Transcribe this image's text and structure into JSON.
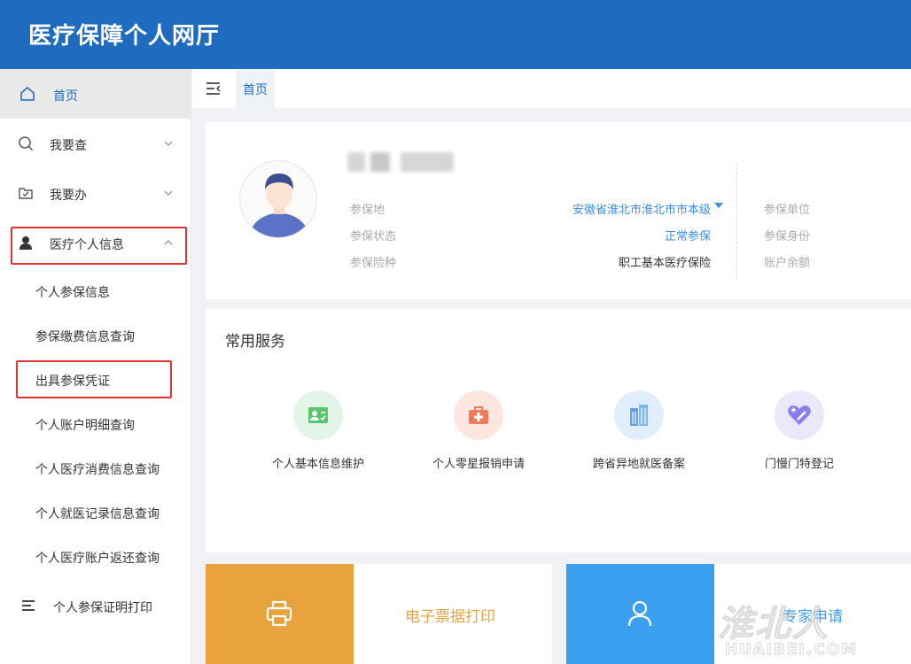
{
  "header": {
    "title": "医疗保障个人网厅"
  },
  "sidebar": {
    "home": "首页",
    "items": [
      {
        "label": "我要查",
        "icon": "search-icon",
        "expanded": false
      },
      {
        "label": "我要办",
        "icon": "folder-check-icon",
        "expanded": false
      },
      {
        "label": "医疗个人信息",
        "icon": "user-icon",
        "expanded": true
      }
    ],
    "sub_items": [
      "个人参保信息",
      "参保缴费信息查询",
      "出具参保凭证",
      "个人账户明细查询",
      "个人医疗消费信息查询",
      "个人就医记录信息查询",
      "个人医疗账户返还查询"
    ],
    "bottom_item": {
      "label": "个人参保证明打印",
      "icon": "list-icon"
    }
  },
  "tabbar": {
    "active_tab": "首页"
  },
  "profile": {
    "fields": [
      {
        "label": "参保地",
        "value": "安徽省淮北市淮北市市本级",
        "color": "#3a8ee6"
      },
      {
        "label": "参保状态",
        "value": "正常参保",
        "color": "#3a8ee6"
      },
      {
        "label": "参保险种",
        "value": "职工基本医疗保险",
        "color": "#333333"
      }
    ],
    "right_labels": [
      "参保单位",
      "参保身份",
      "账户余额"
    ]
  },
  "services": {
    "title": "常用服务",
    "items": [
      {
        "label": "个人基本信息维护",
        "icon": "id-card-icon",
        "bg": "#e3f5e6",
        "fg": "#5cc46e"
      },
      {
        "label": "个人零星报销申请",
        "icon": "medical-kit-icon",
        "bg": "#fde6df",
        "fg": "#f07a5a"
      },
      {
        "label": "跨省异地就医备案",
        "icon": "building-icon",
        "bg": "#e0eefb",
        "fg": "#5aa3e6"
      },
      {
        "label": "门慢门特登记",
        "icon": "heart-edit-icon",
        "bg": "#ebe8fb",
        "fg": "#8a7ff0"
      }
    ]
  },
  "cards": [
    {
      "label": "电子票据打印",
      "icon": "printer-icon",
      "pane_color": "#e8a33d",
      "text_color": "#e8a33d"
    },
    {
      "label": "专家申请",
      "icon": "person-icon",
      "pane_color": "#3b9ff0",
      "text_color": "#3b9ff0"
    }
  ],
  "watermark": {
    "main": "淮北人",
    "sub": "HUAIBEI.COM"
  }
}
